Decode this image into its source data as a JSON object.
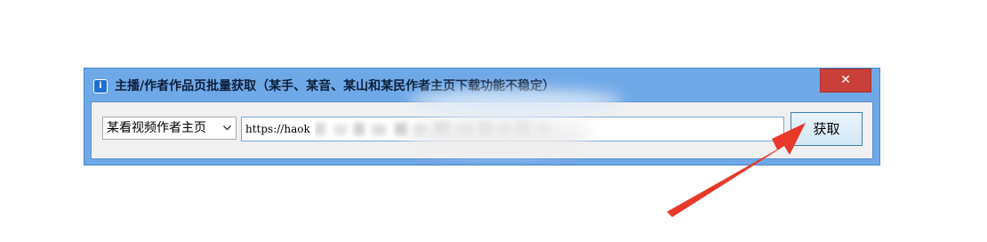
{
  "window": {
    "title": "主播/作者作品页批量获取（某手、某音、某山和某民作者主页下载功能不稳定）",
    "icon_glyph": "i",
    "close_label": "✕"
  },
  "form": {
    "source_select": {
      "selected": "某看视频作者主页",
      "options": [
        "某看视频作者主页"
      ]
    },
    "url_input": {
      "value": "https://haok"
    },
    "fetch_button_label": "获取"
  },
  "colors": {
    "title_bar": "#6fa8e6",
    "close_button": "#c9403a",
    "annotation_arrow": "#e8392a"
  }
}
